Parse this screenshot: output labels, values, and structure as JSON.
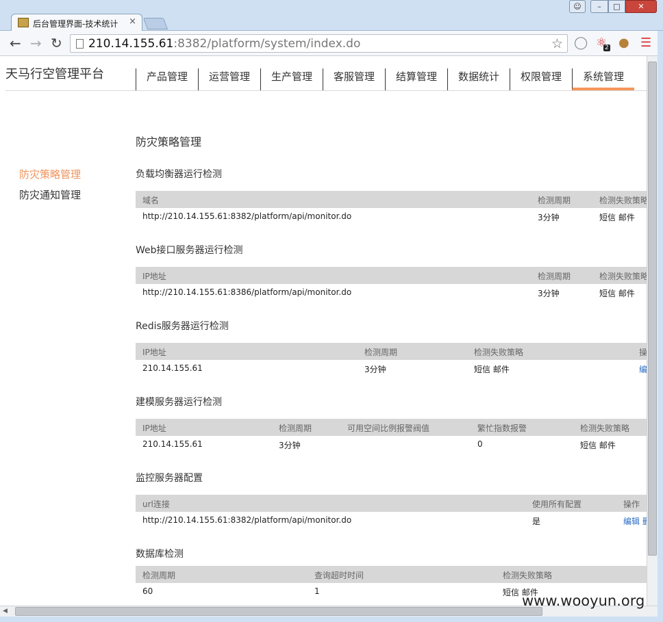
{
  "browser": {
    "tab_title": "后台管理界面-技术统计",
    "tab_close": "×",
    "url_host": "210.14.155.61",
    "url_rest": ":8382/platform/system/index.do",
    "ext_badge": "2",
    "icons": {
      "back": "arrow-left",
      "forward": "arrow-right",
      "reload": "reload",
      "bookmark": "star",
      "menu": "hamburger"
    }
  },
  "app": {
    "brand": "天马行空管理平台",
    "nav": [
      "产品管理",
      "运营管理",
      "生产管理",
      "客服管理",
      "结算管理",
      "数据统计",
      "权限管理",
      "系统管理"
    ],
    "active_nav": "系统管理",
    "accent_color": "#f5955a"
  },
  "sidebar": {
    "items": [
      {
        "label": "防灾策略管理",
        "active": true
      },
      {
        "label": "防灾通知管理",
        "active": false
      }
    ]
  },
  "main": {
    "page_title": "防灾策略管理",
    "sections": [
      {
        "title": "负载均衡器运行检测",
        "columns": [
          "域名",
          "检测周期",
          "检测失败策略"
        ],
        "rows": [
          [
            "http://210.14.155.61:8382/platform/api/monitor.do",
            "3分钟",
            "短信 邮件"
          ]
        ]
      },
      {
        "title": "Web接口服务器运行检测",
        "columns": [
          "IP地址",
          "检测周期",
          "检测失败策略"
        ],
        "rows": [
          [
            "http://210.14.155.61:8386/platform/api/monitor.do",
            "3分钟",
            "短信 邮件"
          ]
        ]
      },
      {
        "title": "Redis服务器运行检测",
        "columns": [
          "IP地址",
          "检测周期",
          "检测失败策略",
          "操"
        ],
        "rows": [
          [
            "210.14.155.61",
            "3分钟",
            "短信 邮件",
            "编"
          ]
        ]
      },
      {
        "title": "建模服务器运行检测",
        "columns": [
          "IP地址",
          "检测周期",
          "可用空间比例报警阀值",
          "繁忙指数报警",
          "检测失败策略"
        ],
        "rows": [
          [
            "210.14.155.61",
            "3分钟",
            "",
            "0",
            "短信 邮件"
          ]
        ]
      },
      {
        "title": "监控服务器配置",
        "columns": [
          "url连接",
          "使用所有配置",
          "操作"
        ],
        "rows": [
          [
            "http://210.14.155.61:8382/platform/api/monitor.do",
            "是",
            "编辑 删"
          ]
        ]
      },
      {
        "title": "数据库检测",
        "columns": [
          "检测周期",
          "查询超时时间",
          "检测失败策略"
        ],
        "rows": [
          [
            "60",
            "1",
            "短信 邮件"
          ]
        ]
      }
    ]
  },
  "watermark": "www.wooyun.org"
}
